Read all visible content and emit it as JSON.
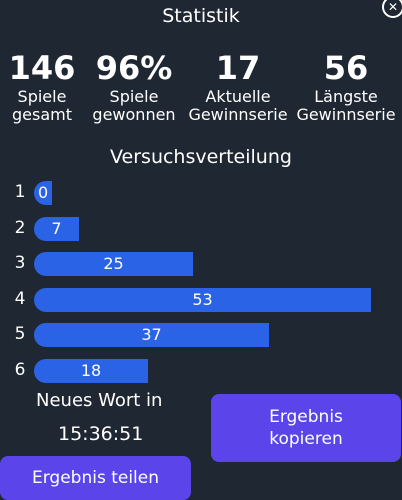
{
  "header": {
    "title": "Statistik",
    "close_icon": "close-icon"
  },
  "stats": [
    {
      "value": "146",
      "label_line1": "Spiele",
      "label_line2": "gesamt"
    },
    {
      "value": "96%",
      "label_line1": "Spiele",
      "label_line2": "gewonnen"
    },
    {
      "value": "17",
      "label_line1": "Aktuelle",
      "label_line2": "Gewinnserie"
    },
    {
      "value": "56",
      "label_line1": "Längste",
      "label_line2": "Gewinnserie"
    }
  ],
  "distribution": {
    "title": "Versuchsverteilung",
    "rows": [
      {
        "guess": "1",
        "count": 0
      },
      {
        "guess": "2",
        "count": 7
      },
      {
        "guess": "3",
        "count": 25
      },
      {
        "guess": "4",
        "count": 53
      },
      {
        "guess": "5",
        "count": 37
      },
      {
        "guess": "6",
        "count": 18
      }
    ],
    "bar_color": "#2a63e6"
  },
  "footer": {
    "next_word_label": "Neues Wort in",
    "timer": "15:36:51",
    "copy_button_line1": "Ergebnis",
    "copy_button_line2": "kopieren",
    "share_button": "Ergebnis teilen",
    "button_color": "#5b45ea"
  }
}
